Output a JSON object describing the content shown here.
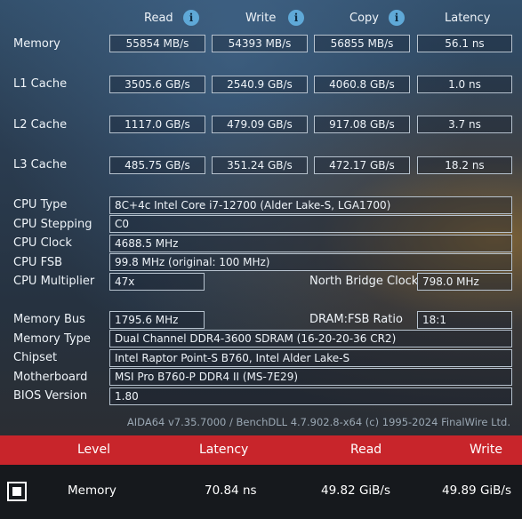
{
  "headers": {
    "read": "Read",
    "write": "Write",
    "copy": "Copy",
    "latency": "Latency"
  },
  "bench": [
    {
      "label": "Memory",
      "read": "55854 MB/s",
      "write": "54393 MB/s",
      "copy": "56855 MB/s",
      "latency": "56.1 ns"
    },
    {
      "label": "L1 Cache",
      "read": "3505.6 GB/s",
      "write": "2540.9 GB/s",
      "copy": "4060.8 GB/s",
      "latency": "1.0 ns"
    },
    {
      "label": "L2 Cache",
      "read": "1117.0 GB/s",
      "write": "479.09 GB/s",
      "copy": "917.08 GB/s",
      "latency": "3.7 ns"
    },
    {
      "label": "L3 Cache",
      "read": "485.75 GB/s",
      "write": "351.24 GB/s",
      "copy": "472.17 GB/s",
      "latency": "18.2 ns"
    }
  ],
  "cpu": {
    "type_label": "CPU Type",
    "type": "8C+4c Intel Core i7-12700  (Alder Lake-S, LGA1700)",
    "stepping_label": "CPU Stepping",
    "stepping": "C0",
    "clock_label": "CPU Clock",
    "clock": "4688.5 MHz",
    "fsb_label": "CPU FSB",
    "fsb": "99.8 MHz  (original: 100 MHz)",
    "mult_label": "CPU Multiplier",
    "mult": "47x",
    "nb_label": "North Bridge Clock",
    "nb": "798.0 MHz"
  },
  "mem": {
    "bus_label": "Memory Bus",
    "bus": "1795.6 MHz",
    "ratio_label": "DRAM:FSB Ratio",
    "ratio": "18:1",
    "type_label": "Memory Type",
    "type": "Dual Channel DDR4-3600 SDRAM  (16-20-20-36 CR2)",
    "chipset_label": "Chipset",
    "chipset": "Intel Raptor Point-S B760, Intel Alder Lake-S",
    "mobo_label": "Motherboard",
    "mobo": "MSI Pro B760-P DDR4 II (MS-7E29)",
    "bios_label": "BIOS Version",
    "bios": "1.80"
  },
  "footer": "AIDA64 v7.35.7000 / BenchDLL 4.7.902.8-x64  (c) 1995-2024 FinalWire Ltd.",
  "results_header": {
    "level": "Level",
    "latency": "Latency",
    "read": "Read",
    "write": "Write"
  },
  "results_row": {
    "level": "Memory",
    "latency": "70.84 ns",
    "read": "49.82 GiB/s",
    "write": "49.89 GiB/s",
    "checked": true
  },
  "icons": {
    "info": "info-icon",
    "checkbox": "checkbox-icon"
  },
  "colors": {
    "accent_red": "#c8252b",
    "info_blue": "#5fa9d8"
  }
}
